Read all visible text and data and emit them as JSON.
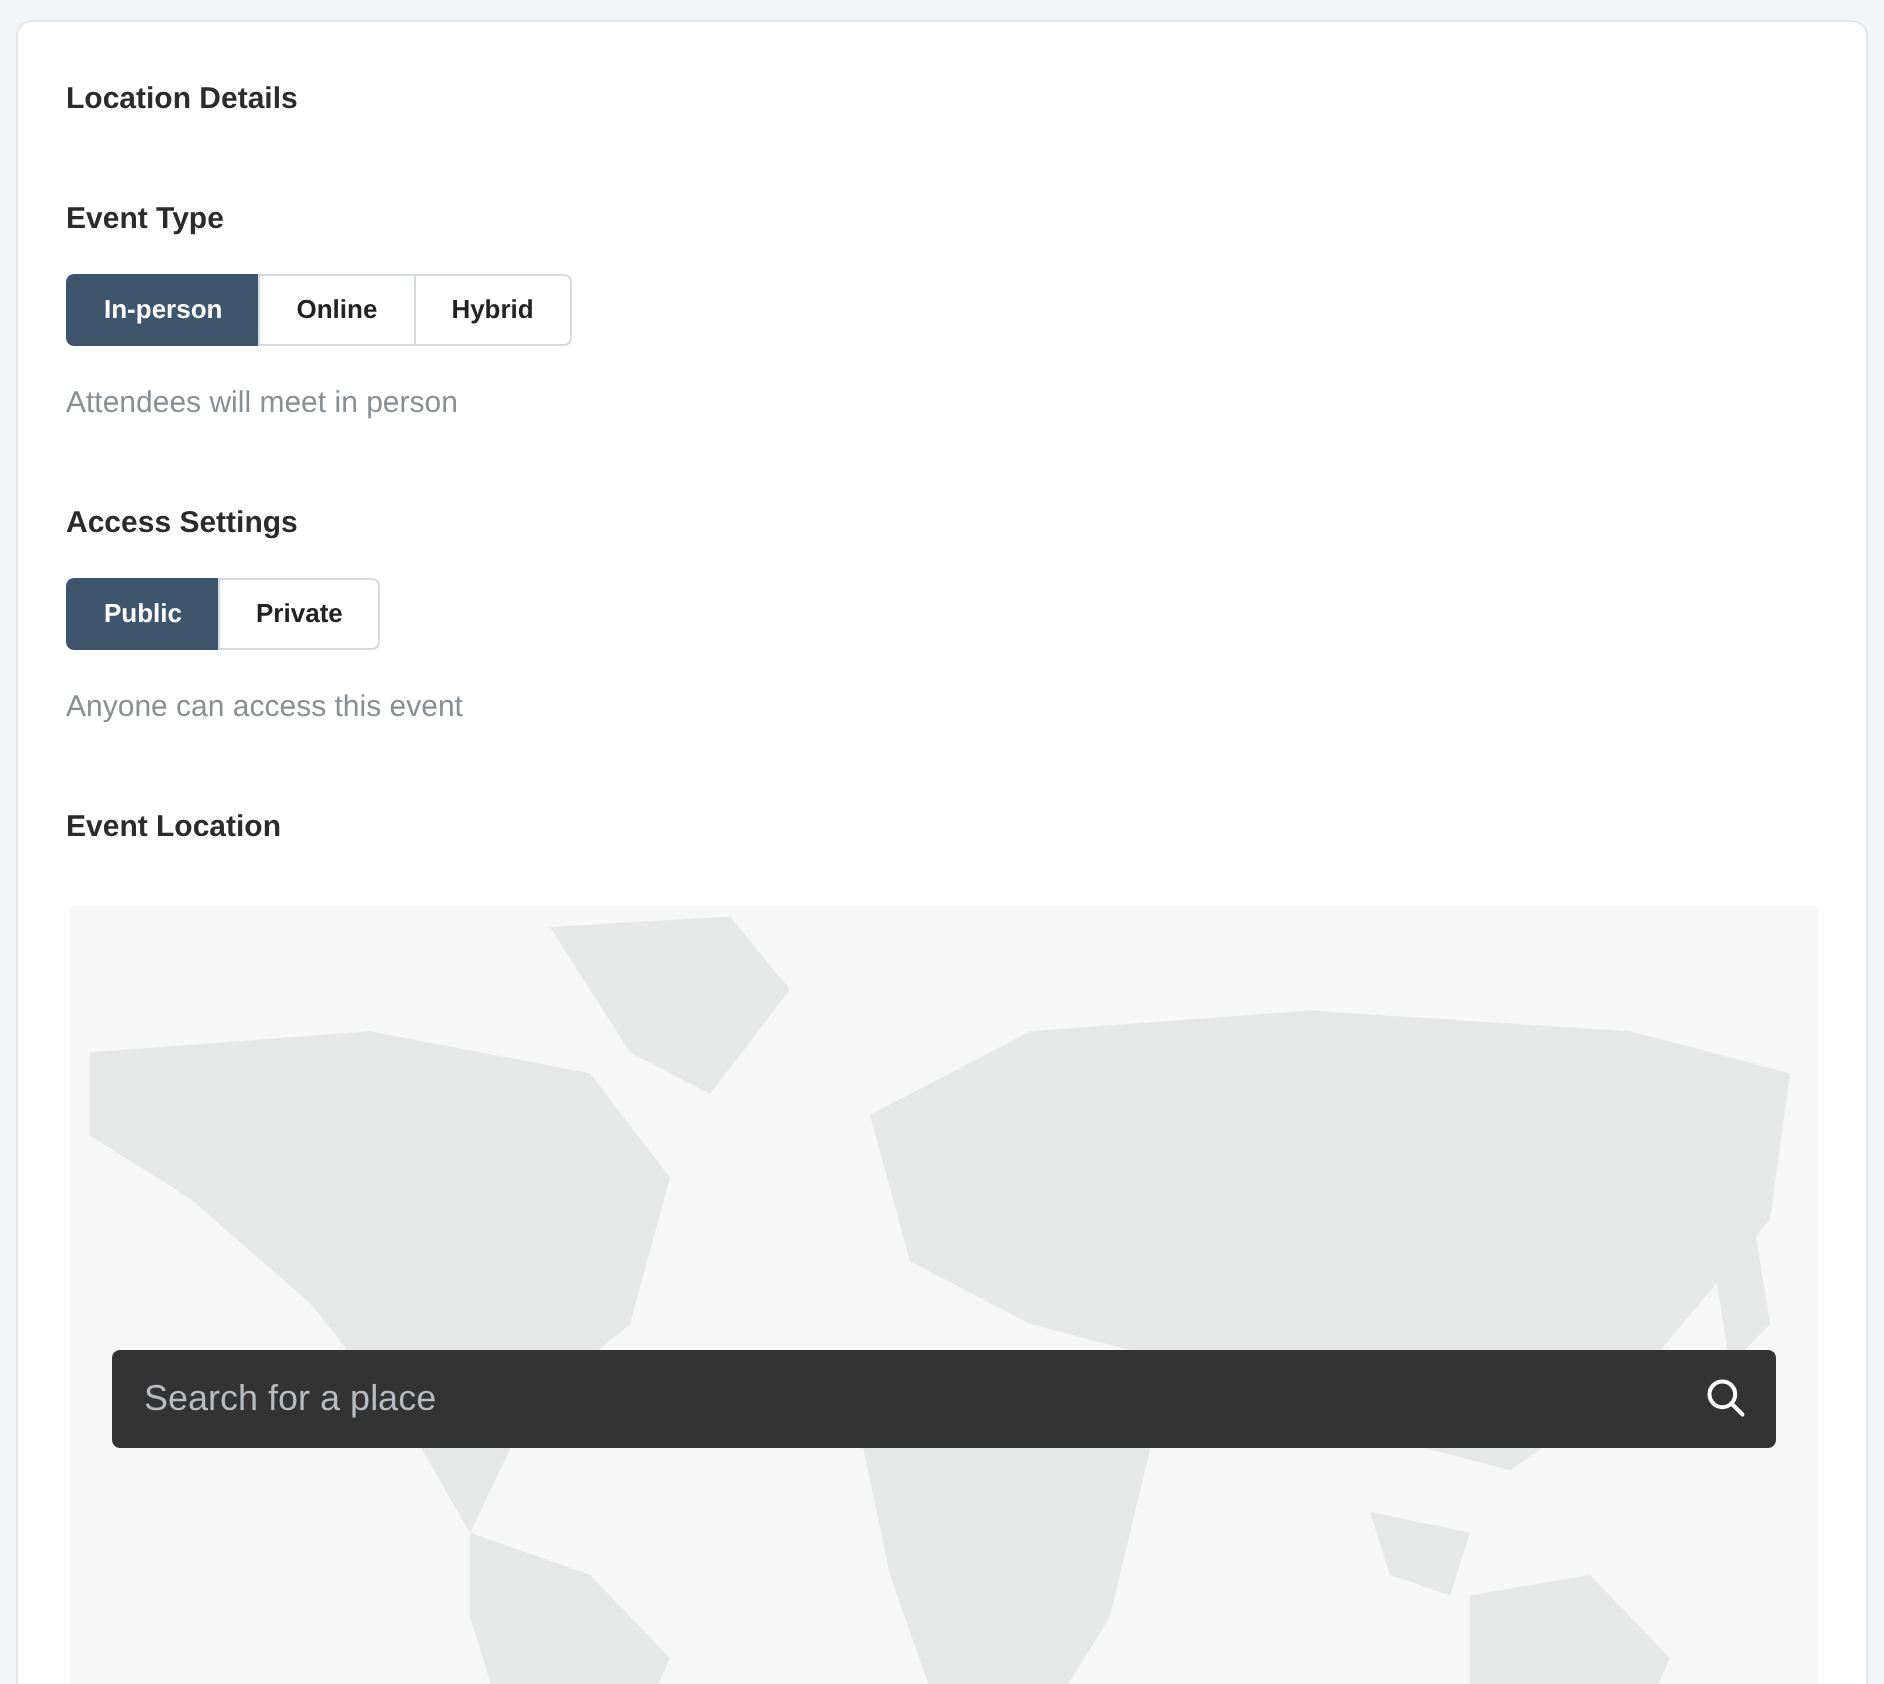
{
  "card": {
    "title": "Location Details"
  },
  "event_type": {
    "label": "Event Type",
    "options": [
      {
        "label": "In-person",
        "selected": true
      },
      {
        "label": "Online",
        "selected": false
      },
      {
        "label": "Hybrid",
        "selected": false
      }
    ],
    "hint": "Attendees will meet in person"
  },
  "access": {
    "label": "Access Settings",
    "options": [
      {
        "label": "Public",
        "selected": true
      },
      {
        "label": "Private",
        "selected": false
      }
    ],
    "hint": "Anyone can access this event"
  },
  "location": {
    "label": "Event Location",
    "search": {
      "placeholder": "Search for a place"
    }
  }
}
